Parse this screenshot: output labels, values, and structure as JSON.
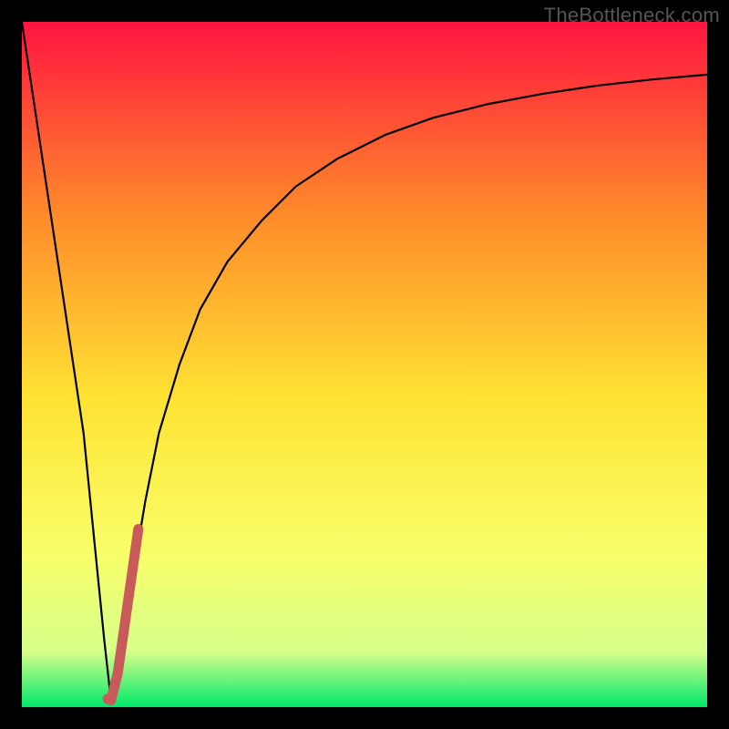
{
  "chart_data": {
    "type": "line",
    "title": "",
    "xlabel": "",
    "ylabel": "",
    "xlim": [
      0,
      100
    ],
    "ylim": [
      0,
      100
    ],
    "series": [
      {
        "name": "bottleneck-curve",
        "x": [
          0,
          3,
          6,
          9,
          11,
          12,
          13,
          14,
          16,
          18,
          20,
          23,
          26,
          30,
          35,
          40,
          46,
          53,
          60,
          68,
          76,
          84,
          92,
          100
        ],
        "values": [
          100,
          80,
          60,
          40,
          20,
          10,
          1,
          5,
          18,
          30,
          40,
          50,
          58,
          65,
          71,
          76,
          80,
          83.5,
          86,
          88,
          89.5,
          90.7,
          91.6,
          92.3
        ]
      },
      {
        "name": "highlight-segment",
        "x": [
          12.5,
          13,
          14,
          15,
          16,
          17
        ],
        "values": [
          1.2,
          1.0,
          5,
          12,
          19,
          26
        ]
      }
    ],
    "gradient_colors": {
      "top": "#ff1440",
      "mid_upper": "#ff8a2a",
      "mid": "#ffe333",
      "mid_lower": "#f8ff6a",
      "lower": "#d6ff8a",
      "bottom": "#00e86b"
    },
    "highlight_color": "#c95a5a",
    "curve_color": "#000000"
  },
  "watermark": "TheBottleneck.com"
}
